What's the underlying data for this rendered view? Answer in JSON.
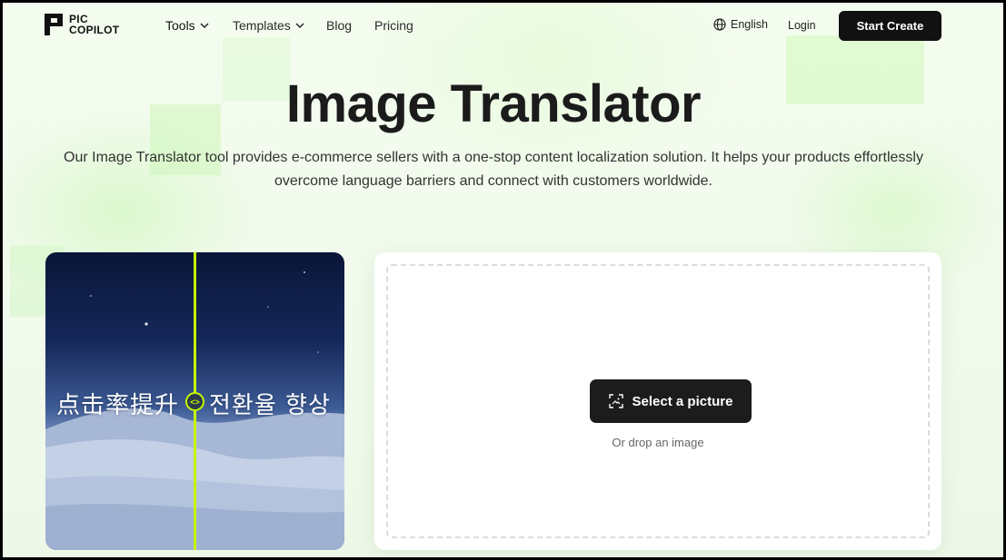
{
  "logo": {
    "line1": "PIC",
    "line2": "COPILOT"
  },
  "nav": {
    "tools": "Tools",
    "templates": "Templates",
    "blog": "Blog",
    "pricing": "Pricing",
    "language": "English",
    "login": "Login",
    "start_create": "Start Create"
  },
  "hero": {
    "title": "Image Translator",
    "subtitle": "Our Image Translator tool provides e-commerce sellers with a one-stop content localization solution. It helps your products effortlessly overcome language barriers and connect with customers worldwide."
  },
  "preview": {
    "text_original": "点击率提升",
    "text_translated": "전환율 향상",
    "handle_glyph": "<>"
  },
  "upload": {
    "button_label": "Select a picture",
    "hint": "Or drop an image"
  },
  "colors": {
    "accent_lime": "#c6f400",
    "button_dark": "#111111",
    "background": "#f3fbee"
  },
  "icons": {
    "globe": "globe-icon",
    "chevron": "chevron-down-icon",
    "image_scan": "image-scan-icon"
  }
}
